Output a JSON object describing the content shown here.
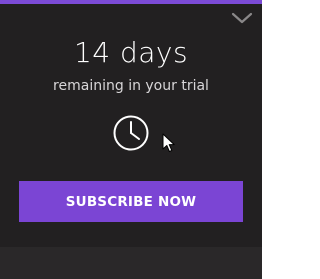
{
  "trial_card": {
    "days_remaining": "14 days",
    "subtitle": "remaining in your trial",
    "subscribe_label": "SUBSCRIBE NOW",
    "clock_icon": "clock-icon",
    "collapse_icon": "chevron-down-icon"
  },
  "colors": {
    "background": "#222021",
    "accent": "#7b45d4",
    "text": "#ffffff"
  }
}
